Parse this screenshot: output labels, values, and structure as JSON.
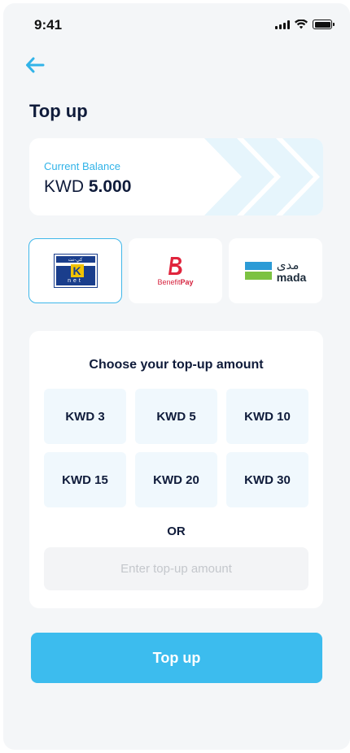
{
  "status_bar": {
    "time": "9:41"
  },
  "header": {
    "title": "Top up"
  },
  "balance": {
    "label": "Current Balance",
    "currency": "KWD",
    "amount": "5.000"
  },
  "payment_methods": [
    {
      "name": "knet",
      "label_top": "كي-نت",
      "label_bottom": "net",
      "letter": "K",
      "selected": true
    },
    {
      "name": "benefitpay",
      "letter": "B",
      "text_regular": "Benefit",
      "text_bold": "Pay",
      "selected": false
    },
    {
      "name": "mada",
      "arabic": "مدى",
      "english": "mada",
      "selected": false
    }
  ],
  "amount": {
    "title": "Choose your top-up amount",
    "options": [
      "KWD 3",
      "KWD 5",
      "KWD 10",
      "KWD 15",
      "KWD 20",
      "KWD 30"
    ],
    "or_label": "OR",
    "input_placeholder": "Enter top-up amount",
    "input_value": ""
  },
  "submit": {
    "label": "Top up"
  },
  "colors": {
    "accent": "#3cbcee",
    "dark": "#0f1b3a",
    "background": "#f4f6f8",
    "option_bg": "#f0f8fd"
  }
}
